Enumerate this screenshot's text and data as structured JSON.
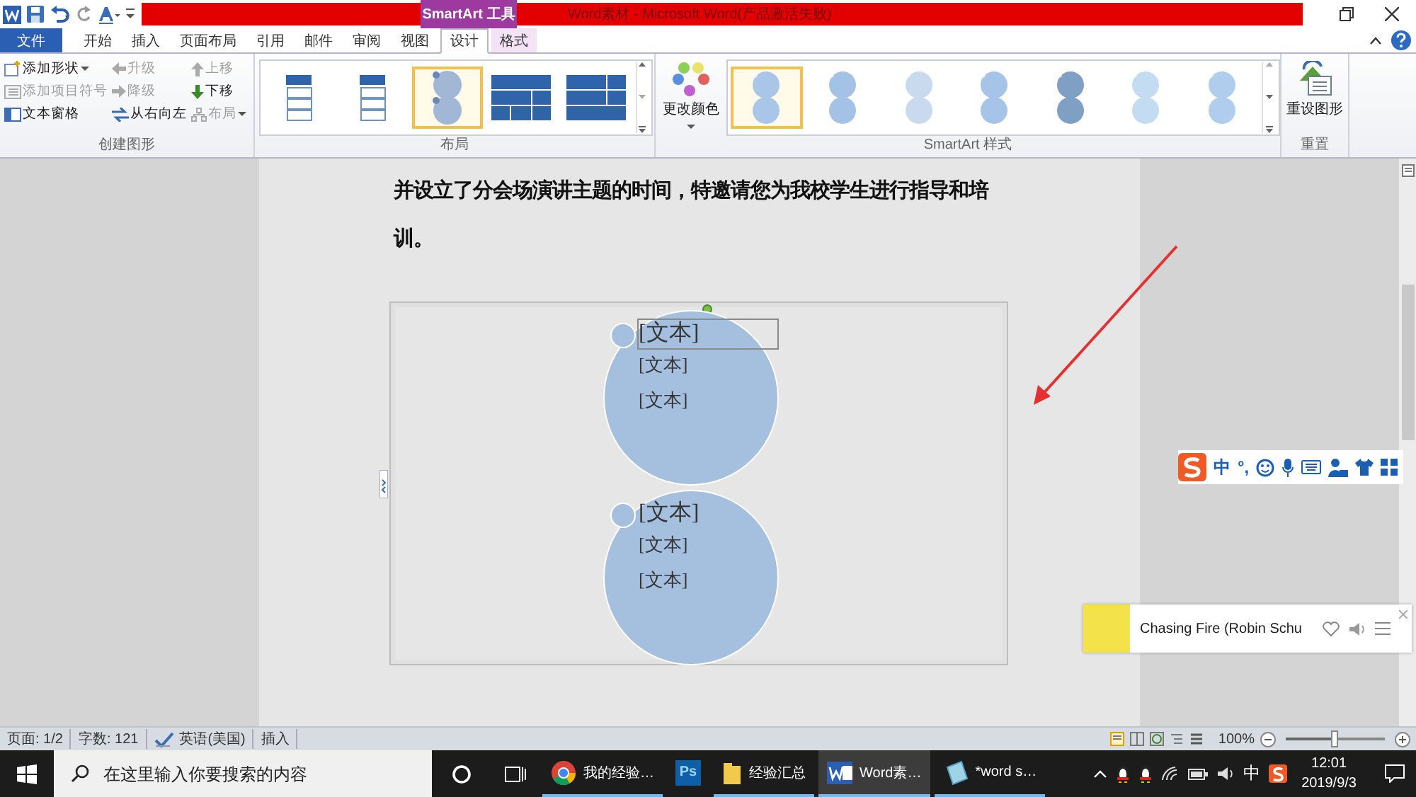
{
  "window": {
    "title": "Word素材 - Microsoft Word(产品激活失败)",
    "context_group": "SmartArt 工具"
  },
  "tabs": [
    {
      "label": "文件",
      "kind": "file",
      "selected": false
    },
    {
      "label": "开始",
      "kind": "normal",
      "selected": false
    },
    {
      "label": "插入",
      "kind": "normal",
      "selected": false
    },
    {
      "label": "页面布局",
      "kind": "normal",
      "selected": false
    },
    {
      "label": "引用",
      "kind": "normal",
      "selected": false
    },
    {
      "label": "邮件",
      "kind": "normal",
      "selected": false
    },
    {
      "label": "审阅",
      "kind": "normal",
      "selected": false
    },
    {
      "label": "视图",
      "kind": "normal",
      "selected": false
    },
    {
      "label": "设计",
      "kind": "context",
      "selected": true
    },
    {
      "label": "格式",
      "kind": "context",
      "selected": false
    }
  ],
  "ribbon": {
    "create_graphic": {
      "title": "创建图形",
      "columns": [
        [
          {
            "label": "添加形状",
            "kind": "add-shape",
            "dropdown": true,
            "disabled": false
          },
          {
            "label": "添加项目符号",
            "kind": "bullet",
            "dropdown": false,
            "disabled": true
          },
          {
            "label": "文本窗格",
            "kind": "text-pane",
            "dropdown": false,
            "disabled": false
          }
        ],
        [
          {
            "label": "升级",
            "kind": "promote",
            "dropdown": false,
            "disabled": true
          },
          {
            "label": "降级",
            "kind": "demote",
            "dropdown": false,
            "disabled": true
          },
          {
            "label": "从右向左",
            "kind": "right-to-left",
            "dropdown": false,
            "disabled": false
          }
        ],
        [
          {
            "label": "上移",
            "kind": "move-up",
            "dropdown": false,
            "disabled": true
          },
          {
            "label": "下移",
            "kind": "move-down",
            "dropdown": false,
            "disabled": false
          },
          {
            "label": "布局",
            "kind": "layout",
            "dropdown": true,
            "disabled": true
          }
        ]
      ]
    },
    "layouts": {
      "title": "布局",
      "items": [
        {
          "kind": "list",
          "selected": false
        },
        {
          "kind": "list",
          "selected": false
        },
        {
          "kind": "circles",
          "selected": true
        },
        {
          "kind": "blocks",
          "selected": false
        },
        {
          "kind": "grid",
          "selected": false
        }
      ]
    },
    "styles": {
      "title": "SmartArt 样式",
      "change_colors": "更改颜色",
      "items": [
        {
          "color": "#a9c6e8",
          "selected": true
        },
        {
          "color": "#a3c2e6",
          "selected": false
        },
        {
          "color": "#c9d9ee",
          "selected": false
        },
        {
          "color": "#a6c4e8",
          "selected": false
        },
        {
          "color": "#7f9fc4",
          "selected": false
        },
        {
          "color": "#c4dcf2",
          "selected": false
        },
        {
          "color": "#b0cdee",
          "selected": false
        }
      ]
    },
    "reset": {
      "title": "重置",
      "button": "重设图形"
    }
  },
  "document": {
    "paragraph": "并设立了分会场演讲主题的时间，特邀请您为我校学生进行指导和培训。",
    "smartart": {
      "shapes": [
        {
          "texts": [
            {
              "text": "[文本]",
              "selected": true
            },
            {
              "text": "[文本]",
              "selected": false
            },
            {
              "text": "[文本]",
              "selected": false
            }
          ]
        },
        {
          "texts": [
            {
              "text": "[文本]",
              "selected": false
            },
            {
              "text": "[文本]",
              "selected": false
            },
            {
              "text": "[文本]",
              "selected": false
            }
          ]
        }
      ]
    }
  },
  "ime_bar": {
    "mode": "中",
    "punctuation": "°,"
  },
  "music_player": {
    "title": "Chasing Fire (Robin Schu"
  },
  "status_bar": {
    "items": [
      {
        "kind": "text",
        "text": "页面: 1/2"
      },
      {
        "kind": "text",
        "text": "字数: 121"
      },
      {
        "kind": "language",
        "text": "英语(美国)"
      },
      {
        "kind": "text",
        "text": "插入"
      }
    ],
    "zoom": {
      "reading": "100%",
      "level": 0.5
    }
  },
  "taskbar": {
    "search": {
      "placeholder": "在这里输入你要搜索的内容"
    },
    "apps": [
      {
        "kind": "chrome",
        "label": "我的经验…",
        "active": false,
        "open": true
      },
      {
        "kind": "photoshop",
        "label": "Ps",
        "active": false,
        "open": false
      },
      {
        "kind": "folder",
        "label": "经验汇总",
        "active": false,
        "open": true
      },
      {
        "kind": "word",
        "label": "Word素…",
        "active": true,
        "open": true
      },
      {
        "kind": "notes",
        "label": "*word s…",
        "active": false,
        "open": true
      }
    ],
    "ime": "中",
    "time": "12:01",
    "date": "2019/9/3"
  }
}
